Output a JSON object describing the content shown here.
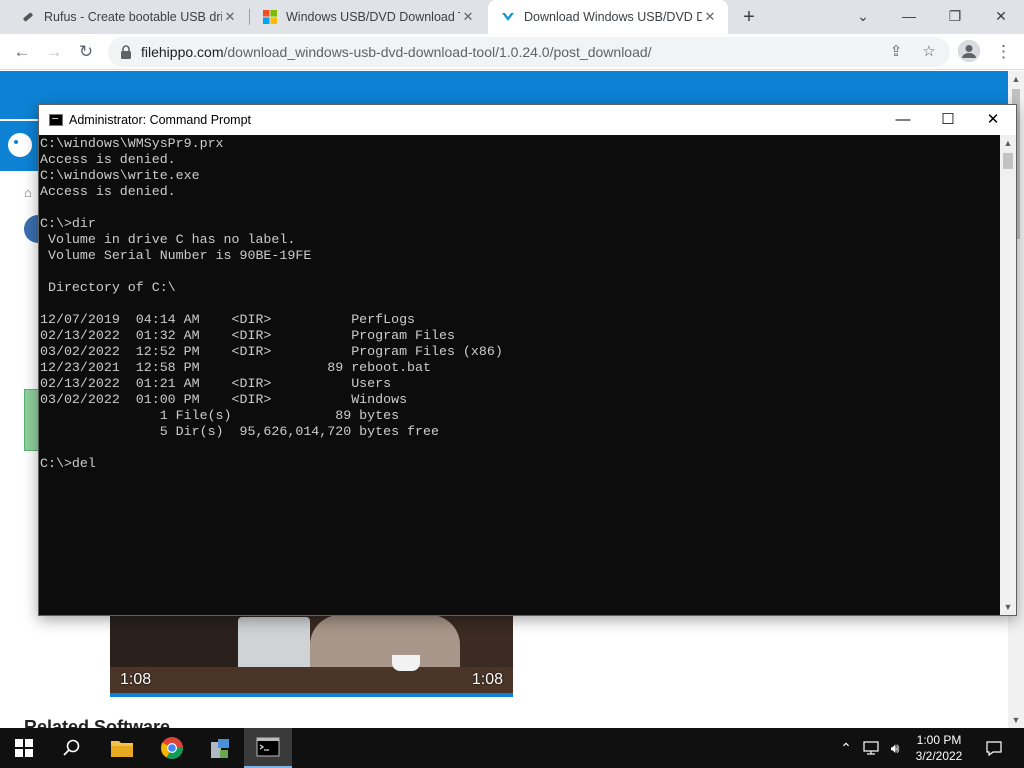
{
  "browser": {
    "tabs": [
      {
        "title": "Rufus - Create bootable USB drive",
        "active": false
      },
      {
        "title": "Windows USB/DVD Download Tool",
        "active": false
      },
      {
        "title": "Download Windows USB/DVD Download Tool",
        "active": true
      }
    ],
    "url_host": "filehippo.com",
    "url_path": "/download_windows-usb-dvd-download-tool/1.0.24.0/post_download/"
  },
  "page": {
    "video_time_left": "1:08",
    "video_time_right": "1:08",
    "related_title": "Related Software"
  },
  "cmd": {
    "title": "Administrator: Command Prompt",
    "lines": [
      "C:\\windows\\WMSysPr9.prx",
      "Access is denied.",
      "C:\\windows\\write.exe",
      "Access is denied.",
      "",
      "C:\\>dir",
      " Volume in drive C has no label.",
      " Volume Serial Number is 90BE-19FE",
      "",
      " Directory of C:\\",
      "",
      "12/07/2019  04:14 AM    <DIR>          PerfLogs",
      "02/13/2022  01:32 AM    <DIR>          Program Files",
      "03/02/2022  12:52 PM    <DIR>          Program Files (x86)",
      "12/23/2021  12:58 PM                89 reboot.bat",
      "02/13/2022  01:21 AM    <DIR>          Users",
      "03/02/2022  01:00 PM    <DIR>          Windows",
      "               1 File(s)             89 bytes",
      "               5 Dir(s)  95,626,014,720 bytes free",
      "",
      "C:\\>del"
    ]
  },
  "taskbar": {
    "apps": [
      "start",
      "search",
      "file-explorer",
      "chrome",
      "server-manager",
      "command-prompt"
    ],
    "time": "1:00 PM",
    "date": "3/2/2022"
  },
  "colors": {
    "page_header": "#0d82d4",
    "console_bg": "#0c0c0c",
    "console_text": "#cccccc",
    "taskbar": "#101010"
  }
}
